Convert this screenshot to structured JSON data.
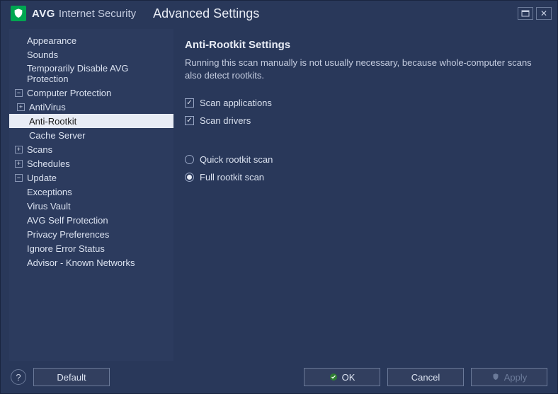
{
  "app": {
    "brand": "AVG",
    "product": "Internet Security",
    "pageTitle": "Advanced Settings"
  },
  "sidebar": {
    "items": [
      {
        "label": "Appearance",
        "level": 0,
        "expand": ""
      },
      {
        "label": "Sounds",
        "level": 0,
        "expand": ""
      },
      {
        "label": "Temporarily Disable AVG Protection",
        "level": 0,
        "expand": ""
      },
      {
        "label": "Computer Protection",
        "level": 0,
        "expand": "-"
      },
      {
        "label": "AntiVirus",
        "level": 1,
        "expand": "+"
      },
      {
        "label": "Anti-Rootkit",
        "level": 1,
        "expand": "",
        "selected": true
      },
      {
        "label": "Cache Server",
        "level": 1,
        "expand": ""
      },
      {
        "label": "Scans",
        "level": 0,
        "expand": "+"
      },
      {
        "label": "Schedules",
        "level": 0,
        "expand": "+"
      },
      {
        "label": "Update",
        "level": 0,
        "expand": "-"
      },
      {
        "label": "Exceptions",
        "level": 0,
        "expand": ""
      },
      {
        "label": "Virus Vault",
        "level": 0,
        "expand": ""
      },
      {
        "label": "AVG Self Protection",
        "level": 0,
        "expand": ""
      },
      {
        "label": "Privacy Preferences",
        "level": 0,
        "expand": ""
      },
      {
        "label": "Ignore Error Status",
        "level": 0,
        "expand": ""
      },
      {
        "label": "Advisor - Known Networks",
        "level": 0,
        "expand": ""
      }
    ]
  },
  "main": {
    "heading": "Anti-Rootkit Settings",
    "description": "Running this scan manually is not usually necessary, because whole-computer scans also detect rootkits.",
    "checkboxes": [
      {
        "label": "Scan applications",
        "checked": true
      },
      {
        "label": "Scan drivers",
        "checked": true
      }
    ],
    "radios": [
      {
        "label": "Quick rootkit scan",
        "checked": false
      },
      {
        "label": "Full rootkit scan",
        "checked": true
      }
    ]
  },
  "footer": {
    "help": "?",
    "default": "Default",
    "ok": "OK",
    "cancel": "Cancel",
    "apply": "Apply"
  }
}
